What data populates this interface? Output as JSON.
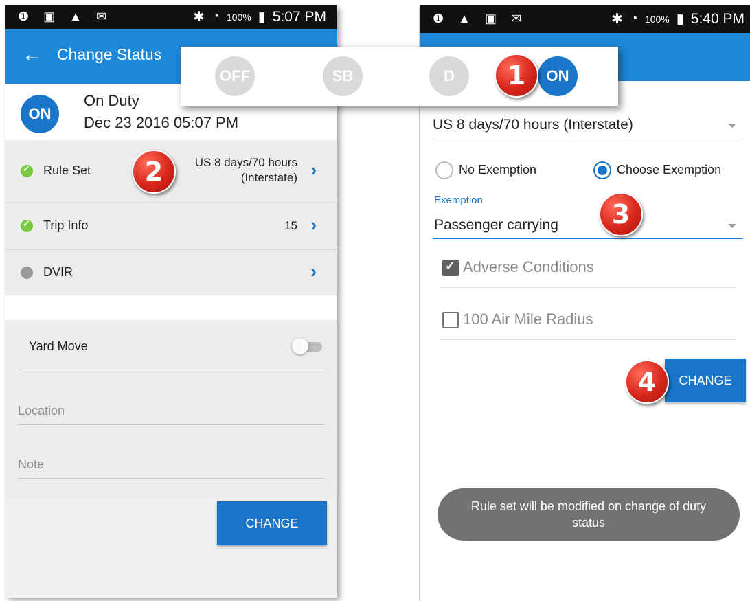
{
  "left": {
    "status_bar": {
      "left_icons": "❶ ▣ ▲ ✉",
      "battery": "100%",
      "time": "5:07 PM"
    },
    "app_bar": {
      "back_icon": "←",
      "title": "Change Status"
    },
    "current_status": {
      "badge": "ON",
      "label": "On Duty",
      "datetime": "Dec 23 2016 05:07 PM"
    },
    "rows": [
      {
        "label": "Rule Set",
        "value_line1": "US 8 days/70 hours",
        "value_line2": "(Interstate)",
        "indicator": "green"
      },
      {
        "label": "Trip Info",
        "value_line1": "15",
        "value_line2": "",
        "indicator": "green"
      },
      {
        "label": "DVIR",
        "value_line1": "",
        "value_line2": "",
        "indicator": "gray"
      }
    ],
    "yard_move": {
      "label": "Yard Move",
      "enabled": false
    },
    "location": {
      "placeholder": "Location"
    },
    "note": {
      "placeholder": "Note"
    },
    "change_button": "CHANGE"
  },
  "status_popup": {
    "options": [
      {
        "label": "OFF",
        "selected": false
      },
      {
        "label": "SB",
        "selected": false
      },
      {
        "label": "D",
        "selected": false
      },
      {
        "label": "ON",
        "selected": true
      }
    ]
  },
  "markers": [
    "1",
    "2",
    "3",
    "4"
  ],
  "right": {
    "status_bar": {
      "left_icons": "❶ ▲ ▣ ✉",
      "battery": "100%",
      "time": "5:40 PM"
    },
    "ruleset_dropdown": "US 8 days/70 hours (Interstate)",
    "exemption_choice": {
      "no_exemption": "No Exemption",
      "choose_exemption": "Choose Exemption",
      "selected": "Choose Exemption"
    },
    "exemption": {
      "label": "Exemption",
      "value": "Passenger carrying"
    },
    "checkboxes": [
      {
        "label": "Adverse Conditions",
        "checked": true
      },
      {
        "label": "100 Air Mile Radius",
        "checked": false
      }
    ],
    "change_button": "CHANGE",
    "toast": "Rule set will be modified on change of duty status"
  },
  "colors": {
    "primary": "#1d87d8",
    "accent": "#1a76c8",
    "marker": "#d7261b",
    "ok": "#7ac943"
  }
}
